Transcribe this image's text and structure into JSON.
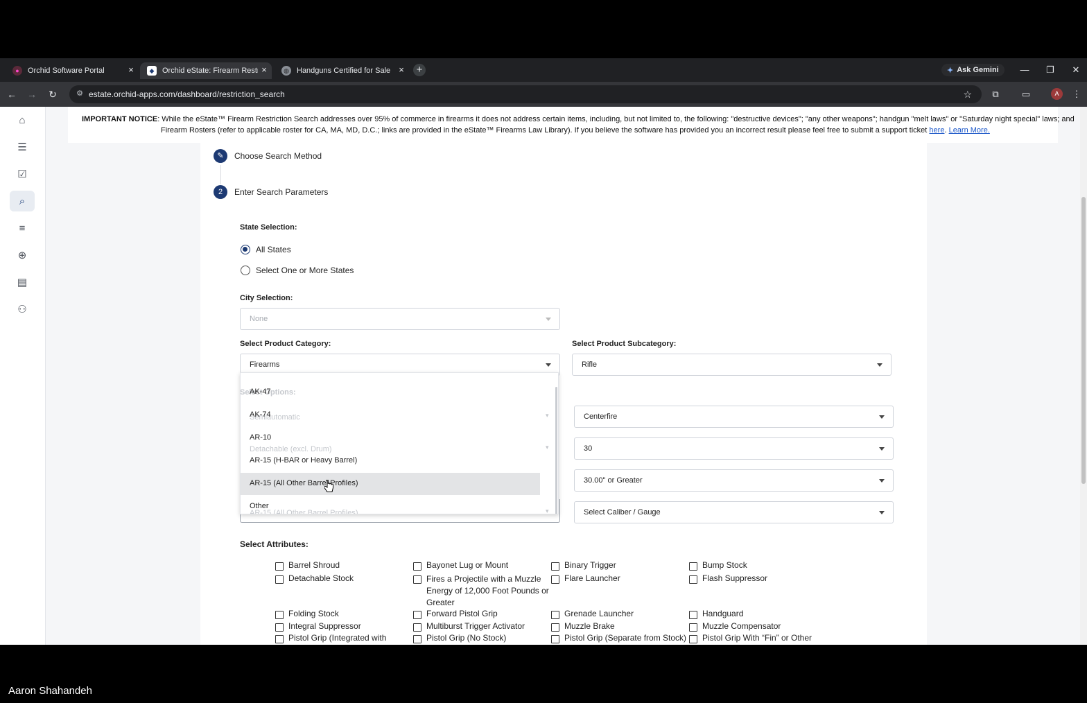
{
  "browser": {
    "tabs": [
      {
        "title": "Orchid Software Portal",
        "icon": "orchid-logo-icon"
      },
      {
        "title": "Orchid eState: Firearm Restrictio",
        "icon": "orchid-logo-icon"
      },
      {
        "title": "Handguns Certified for Sale | St",
        "icon": "globe-icon"
      }
    ],
    "new_tab": "+",
    "gemini_label": "Ask Gemini",
    "url": "estate.orchid-apps.com/dashboard/restriction_search",
    "profile_initial": "A"
  },
  "notice": {
    "heading": "IMPORTANT NOTICE",
    "line1": ": While the eState™ Firearm Restriction Search addresses over 95% of commerce in firearms it does not address certain items, including, but not limited to, the following: \"destructive devices\"; \"any other weapons\"; handgun \"melt laws\" or \"Saturday night special\" laws; and",
    "line2": "Firearm Rosters (refer to applicable roster for CA, MA, MD, D.C.; links are provided in the eState™ Firearms Law Library). If you believe the software has provided you an incorrect result please feel free to submit a support ticket",
    "link_here": "here",
    "link_learn": "Learn More."
  },
  "steps": {
    "step1": {
      "label": "Choose Search Method"
    },
    "step2": {
      "number": "2",
      "label": "Enter Search Parameters"
    }
  },
  "state_selection": {
    "label": "State Selection:",
    "options": [
      "All States",
      "Select One or More States"
    ],
    "selected": "All States"
  },
  "city_selection": {
    "label": "City Selection:",
    "value": "None"
  },
  "product_category": {
    "label": "Select Product Category:",
    "value": "Firearms"
  },
  "product_subcategory": {
    "label": "Select Product Subcategory:",
    "value": "Rifle"
  },
  "options_section": {
    "label": "Select Options:",
    "left_values": [
      "Semiautomatic",
      "Detachable (excl. Drum)",
      "AR-15 (All Other Barrel Profiles)"
    ],
    "right_values": [
      "Centerfire",
      "30",
      "30.00\" or Greater",
      "Select Caliber / Gauge"
    ]
  },
  "dropdown": {
    "options": [
      "AK-47",
      "AK-74",
      "AR-10",
      "AR-15 (H-BAR or Heavy Barrel)",
      "AR-15 (All Other Barrel Profiles)",
      "Other"
    ],
    "hovered": "AR-15 (All Other Barrel Profiles)"
  },
  "attributes": {
    "label": "Select Attributes:",
    "items": [
      "Barrel Shroud",
      "Bayonet Lug or Mount",
      "Binary Trigger",
      "Bump Stock",
      "Detachable Stock",
      "Fires a Projectile with a Muzzle Energy of 12,000 Foot Pounds or Greater",
      "Flare Launcher",
      "Flash Suppressor",
      "Folding Stock",
      "Forward Pistol Grip",
      "Grenade Launcher",
      "Handguard",
      "Integral Suppressor",
      "Multiburst Trigger Activator",
      "Muzzle Brake",
      "Muzzle Compensator",
      "Pistol Grip (Integrated with",
      "Pistol Grip (No Stock)",
      "Pistol Grip (Separate from Stock)",
      "Pistol Grip With “Fin” or Other"
    ]
  },
  "presenter": "Aaron Shahandeh"
}
